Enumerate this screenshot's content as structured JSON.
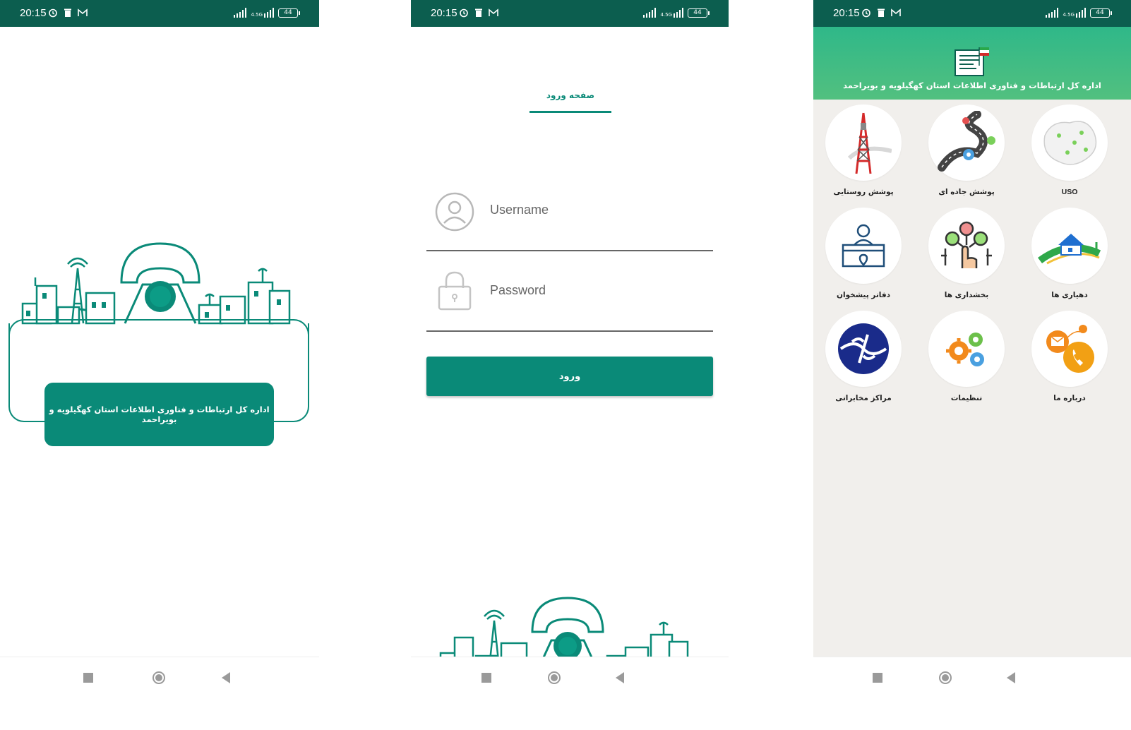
{
  "status_bar": {
    "time": "20:15",
    "battery": "44",
    "network": "4.5G"
  },
  "splash": {
    "org_name": "اداره کل ارتباطات و فناوری اطلاعات استان کهگیلویه و بویراحمد"
  },
  "login": {
    "tab_title": "صفحه ورود",
    "username_placeholder": "Username",
    "password_placeholder": "Password",
    "submit_label": "ورود"
  },
  "dashboard": {
    "header_title": "اداره کل ارتباطات و فناوری اطلاعات استان کهگیلویه و بویراحمد",
    "tiles": [
      {
        "label": "پوشش روستایی",
        "icon": "telecom-tower-icon"
      },
      {
        "label": "پوشش جاده ای",
        "icon": "road-route-icon"
      },
      {
        "label": "USO",
        "icon": "map-points-icon"
      },
      {
        "label": "دفاتر پیشخوان",
        "icon": "service-desk-icon"
      },
      {
        "label": "بخشداری ها",
        "icon": "touch-network-icon"
      },
      {
        "label": "دهیاری ها",
        "icon": "village-house-icon"
      },
      {
        "label": "مراکز مخابراتی",
        "icon": "telecom-logo-icon"
      },
      {
        "label": "تنظیمات",
        "icon": "gears-icon"
      },
      {
        "label": "درباره ما",
        "icon": "contact-phone-icon"
      }
    ]
  },
  "colors": {
    "status_bar": "#0c5e4f",
    "primary": "#0a8a78",
    "header_green": "#3fb98a",
    "dashboard_bg": "#f1efec"
  }
}
